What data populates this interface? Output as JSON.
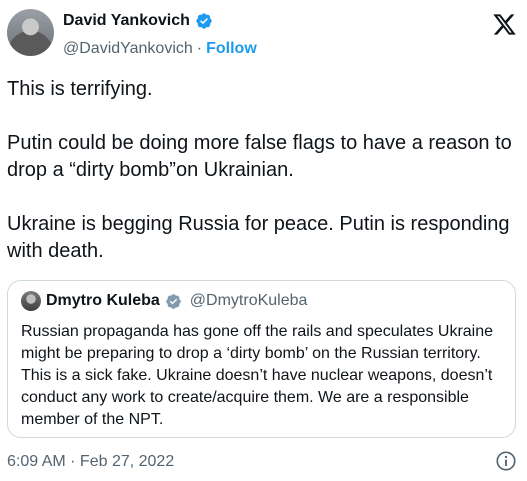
{
  "author": {
    "name": "David Yankovich",
    "handle": "@DavidYankovich",
    "separator": "·",
    "follow_label": "Follow"
  },
  "tweet": {
    "paragraphs": [
      "This is terrifying.",
      "Putin could be doing more false flags to have a reason to drop a “dirty bomb”on Ukrainian.",
      "Ukraine is begging Russia for peace. Putin is responding with death."
    ],
    "timestamp": "6:09 AM · Feb 27, 2022"
  },
  "quote": {
    "name": "Dmytro Kuleba",
    "handle": "@DmytroKuleba",
    "text": "Russian propaganda has gone off the rails and speculates Ukraine might be preparing to drop a ‘dirty bomb’ on the Russian territory. This is a sick fake. Ukraine doesn’t have nuclear weapons, doesn’t conduct any work to create/acquire them. We are a responsible member of the NPT."
  },
  "icons": {
    "verified": "verified-badge-icon",
    "brand": "x-logo-icon",
    "info": "info-icon"
  },
  "colors": {
    "accent": "#1d9bf0",
    "text": "#0f1419",
    "secondary": "#536471",
    "border": "#cfd9de"
  }
}
